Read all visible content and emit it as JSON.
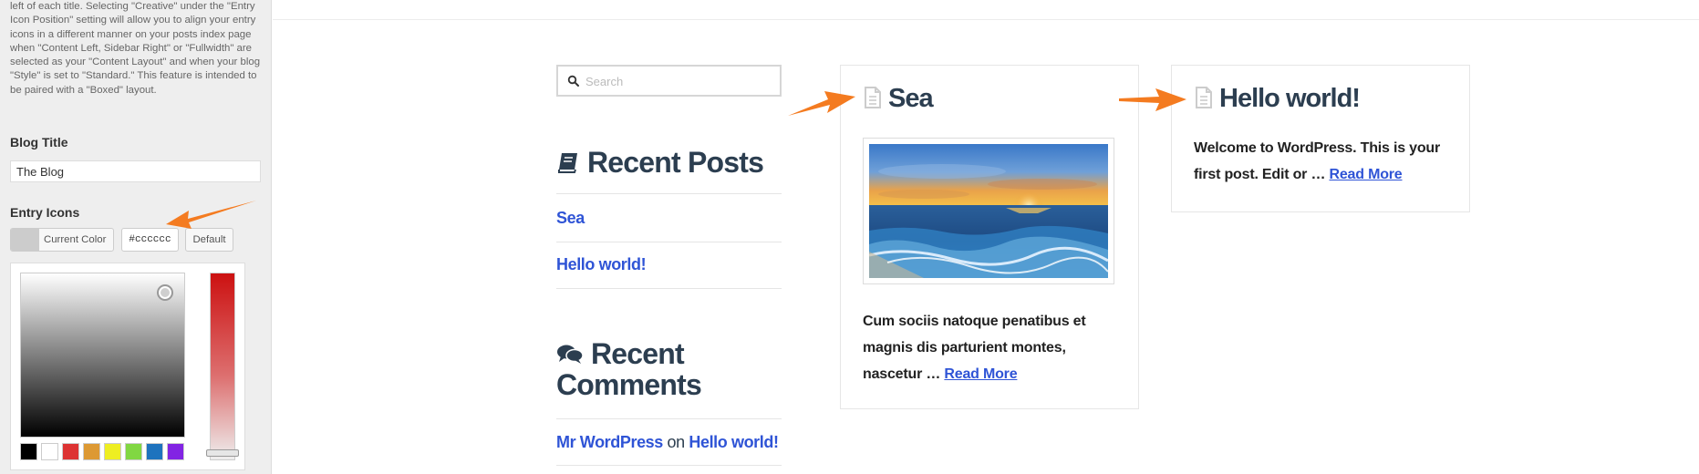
{
  "sidebar": {
    "help_text": "left of each title. Selecting \"Creative\" under the \"Entry Icon Position\" setting will allow you to align your entry icons in a different manner on your posts index page when \"Content Left, Sidebar Right\" or \"Fullwidth\" are selected as your \"Content Layout\" and when your blog \"Style\" is set to \"Standard.\" This feature is intended to be paired with a \"Boxed\" layout.",
    "blog_title_label": "Blog Title",
    "blog_title_value": "The Blog",
    "entry_icons_label": "Entry Icons",
    "current_color_label": "Current Color",
    "hex_value": "#cccccc",
    "default_label": "Default",
    "current_color": "#cccccc",
    "palette": [
      "#000000",
      "#ffffff",
      "#dd3333",
      "#dd9933",
      "#eeee22",
      "#81d742",
      "#1e73be",
      "#8224e3"
    ]
  },
  "search": {
    "placeholder": "Search"
  },
  "recent_posts": {
    "title": "Recent Posts",
    "items": [
      "Sea",
      "Hello world!"
    ]
  },
  "recent_comments": {
    "title": "Recent Comments",
    "author": "Mr WordPress",
    "on": "on",
    "post": "Hello world!"
  },
  "posts": [
    {
      "title": "Sea",
      "excerpt": "Cum sociis natoque penatibus et magnis dis parturient montes, nascetur …",
      "read_more": "Read More"
    },
    {
      "title": "Hello world!",
      "excerpt": "Welcome to WordPress. This is your first post. Edit or …",
      "read_more": "Read More"
    }
  ],
  "colors": {
    "link": "#2f54d6",
    "heading": "#2c3e50",
    "entry_icon": "#cccccc",
    "annotation_arrow": "#f47b20"
  }
}
